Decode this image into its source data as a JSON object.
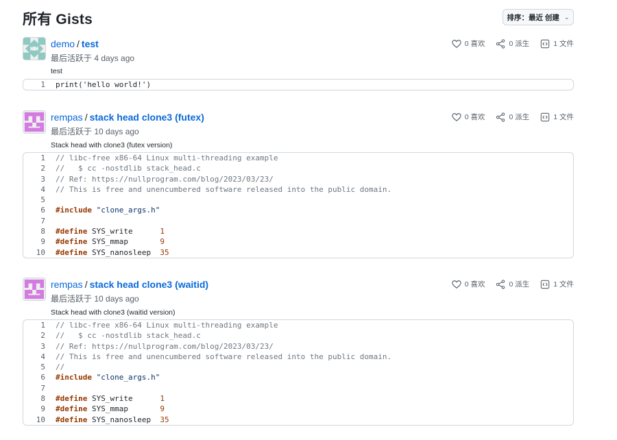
{
  "page": {
    "title": "所有 Gists",
    "sort_label": "排序：最近 创建",
    "sort_chevron": "⌄"
  },
  "gists": [
    {
      "owner": "demo",
      "separator": "/",
      "name": "test",
      "activity": "最后活跃于 4 days ago",
      "description": "test",
      "likes": "0 喜欢",
      "forks": "0 派生",
      "files": "1 文件",
      "lines": [
        {
          "n": "1",
          "text": "print('hello world!')"
        }
      ]
    },
    {
      "owner": "rempas",
      "separator": "/",
      "name": "stack head clone3 (futex)",
      "activity": "最后活跃于 10 days ago",
      "description": "Stack head with clone3 (futex version)",
      "likes": "0 喜欢",
      "forks": "0 派生",
      "files": "1 文件",
      "lines": [
        {
          "n": "1",
          "text": "// libc-free x86-64 Linux multi-threading example"
        },
        {
          "n": "2",
          "text": "//   $ cc -nostdlib stack_head.c"
        },
        {
          "n": "3",
          "text": "// Ref: https://nullprogram.com/blog/2023/03/23/"
        },
        {
          "n": "4",
          "text": "// This is free and unencumbered software released into the public domain."
        },
        {
          "n": "5",
          "text": ""
        },
        {
          "n": "6",
          "text": "#include \"clone_args.h\""
        },
        {
          "n": "7",
          "text": ""
        },
        {
          "n": "8",
          "text": "#define SYS_write      1"
        },
        {
          "n": "9",
          "text": "#define SYS_mmap       9"
        },
        {
          "n": "10",
          "text": "#define SYS_nanosleep  35"
        }
      ]
    },
    {
      "owner": "rempas",
      "separator": "/",
      "name": "stack head clone3 (waitid)",
      "activity": "最后活跃于 10 days ago",
      "description": "Stack head with clone3 (waitid version)",
      "likes": "0 喜欢",
      "forks": "0 派生",
      "files": "1 文件",
      "lines": [
        {
          "n": "1",
          "text": "// libc-free x86-64 Linux multi-threading example"
        },
        {
          "n": "2",
          "text": "//   $ cc -nostdlib stack_head.c"
        },
        {
          "n": "3",
          "text": "// Ref: https://nullprogram.com/blog/2023/03/23/"
        },
        {
          "n": "4",
          "text": "// This is free and unencumbered software released into the public domain."
        },
        {
          "n": "5",
          "text": "//"
        },
        {
          "n": "6",
          "text": "#include \"clone_args.h\""
        },
        {
          "n": "7",
          "text": ""
        },
        {
          "n": "8",
          "text": "#define SYS_write      1"
        },
        {
          "n": "9",
          "text": "#define SYS_mmap       9"
        },
        {
          "n": "10",
          "text": "#define SYS_nanosleep  35"
        }
      ]
    }
  ],
  "icons": {
    "like": "heart-icon",
    "fork": "share-fork-icon",
    "files": "code-file-icon"
  },
  "colors": {
    "link": "#0969da",
    "muted": "#57606a",
    "keyword": "#953800",
    "comment": "#6e7781",
    "string": "#0a3069",
    "border": "#d0d7de",
    "avatar_demo": "#8fc9c2",
    "avatar_rempas": "#d37be0"
  }
}
